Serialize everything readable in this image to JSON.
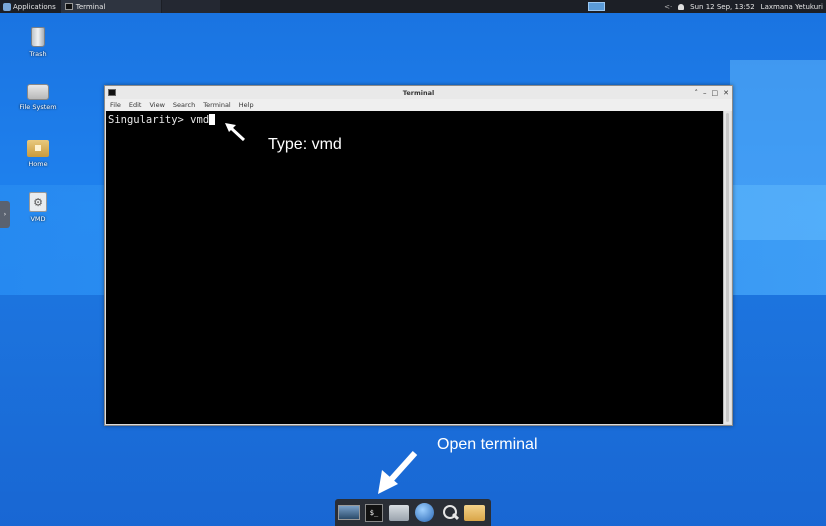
{
  "top_panel": {
    "applications_label": "Applications",
    "task_label": "Terminal",
    "datetime": "Sun 12 Sep, 13:52",
    "user_name": "Laxmana Yetukuri"
  },
  "desktop_icons": {
    "trash": "Trash",
    "file_system": "File System",
    "home": "Home",
    "vmd": "VMD"
  },
  "terminal": {
    "title": "Terminal",
    "menu": [
      "File",
      "Edit",
      "View",
      "Search",
      "Terminal",
      "Help"
    ],
    "prompt_line": "Singularity> vmd"
  },
  "annotations": {
    "type_hint": "Type: vmd",
    "open_hint": "Open terminal"
  },
  "dock": {
    "items": [
      "show-desktop",
      "terminal",
      "file-manager",
      "web-browser",
      "app-finder",
      "folder"
    ]
  }
}
